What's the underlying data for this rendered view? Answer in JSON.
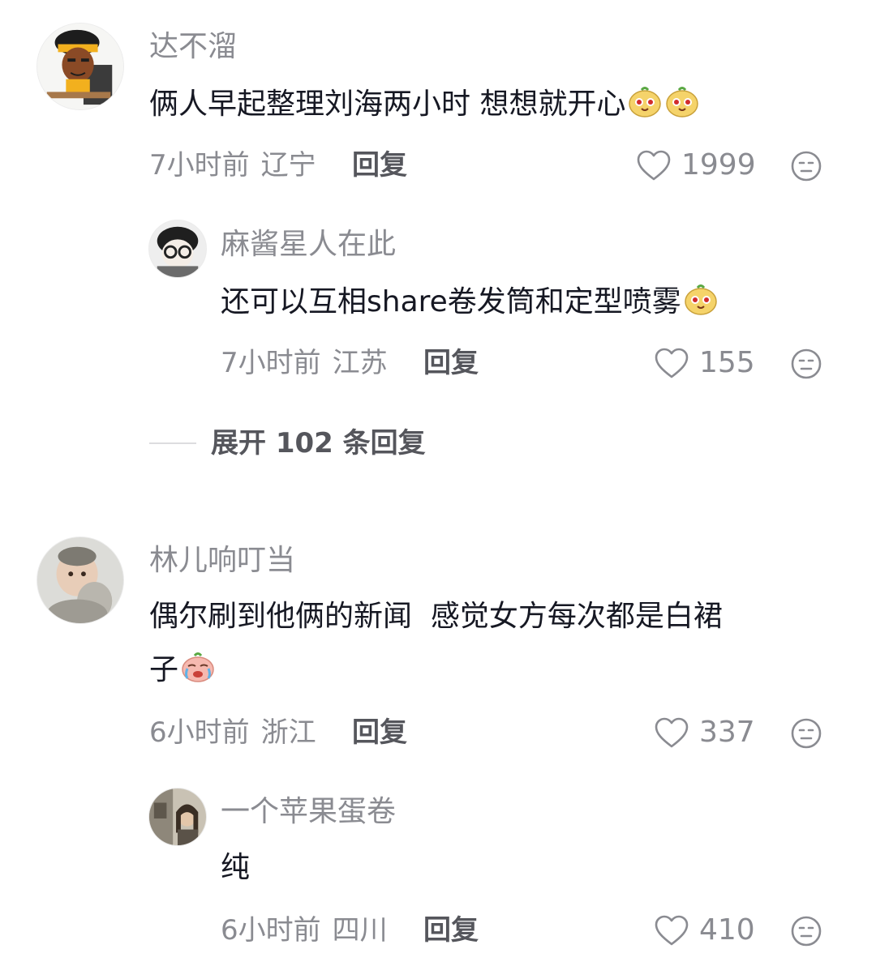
{
  "comments": [
    {
      "username": "达不溜",
      "text": "俩人早起整理刘海两小时 想想就开心",
      "time": "7小时前",
      "location": "辽宁",
      "reply_label": "回复",
      "likes": "1999",
      "replies": [
        {
          "username": "麻酱星人在此",
          "text": "还可以互相share卷发筒和定型喷雾",
          "time": "7小时前",
          "location": "江苏",
          "reply_label": "回复",
          "likes": "155"
        }
      ],
      "expand_label": "展开 102 条回复"
    },
    {
      "username": "林儿响叮当",
      "text_line1": "偶尔刷到他俩的新闻  感觉女方每次都是白裙",
      "text_line2": "子",
      "time": "6小时前",
      "location": "浙江",
      "reply_label": "回复",
      "likes": "337",
      "replies": [
        {
          "username": "一个苹果蛋卷",
          "text": "纯",
          "time": "6小时前",
          "location": "四川",
          "reply_label": "回复",
          "likes": "410"
        }
      ]
    }
  ],
  "colors": {
    "username": "#8a8b91",
    "text": "#161823",
    "meta": "#8a8b91",
    "reply": "#55565c"
  }
}
